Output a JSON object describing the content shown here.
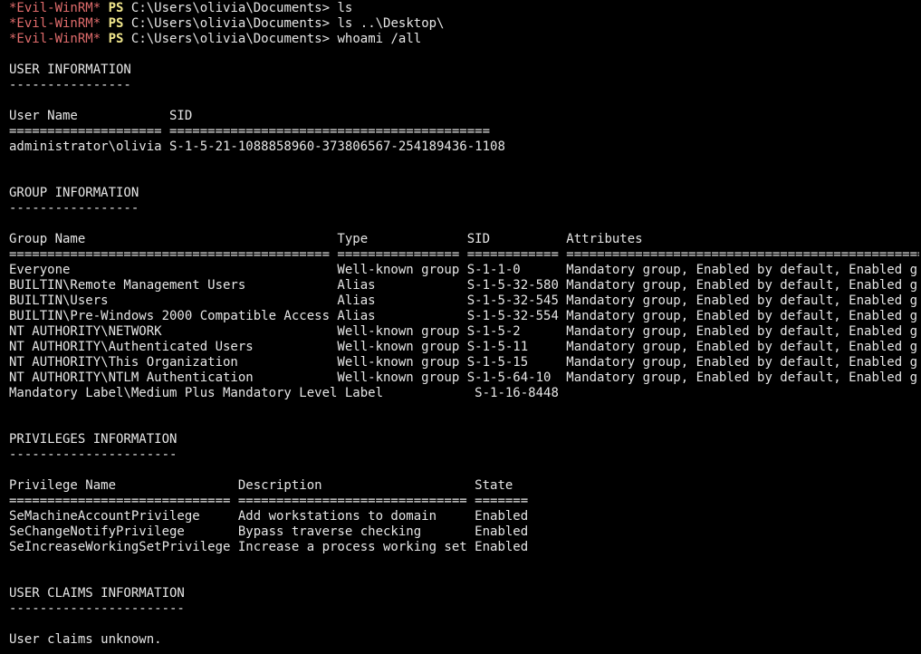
{
  "colors": {
    "background": "#000000",
    "text": "#e6e6e6",
    "prompt_tag": "#e06c6c",
    "ps": "#f0e68c"
  },
  "prompts": [
    {
      "tag": "*Evil-WinRM*",
      "ps": "PS",
      "path": "C:\\Users\\olivia\\Documents>",
      "command": "ls"
    },
    {
      "tag": "*Evil-WinRM*",
      "ps": "PS",
      "path": "C:\\Users\\olivia\\Documents>",
      "command": "ls ..\\Desktop\\"
    },
    {
      "tag": "*Evil-WinRM*",
      "ps": "PS",
      "path": "C:\\Users\\olivia\\Documents>",
      "command": "whoami /all"
    }
  ],
  "output": {
    "user_info": {
      "title": "USER INFORMATION",
      "underline": "----------------",
      "header": "User Name            SID",
      "separator": "==================== ==========================================",
      "row": "administrator\\olivia S-1-5-21-1088858960-373806567-254189436-1108"
    },
    "group_info": {
      "title": "GROUP INFORMATION",
      "underline": "-----------------",
      "header": "Group Name                                 Type             SID          Attributes",
      "separator": "========================================== ================ ============ ==================================================",
      "rows": [
        "Everyone                                   Well-known group S-1-1-0      Mandatory group, Enabled by default, Enabled group",
        "BUILTIN\\Remote Management Users            Alias            S-1-5-32-580 Mandatory group, Enabled by default, Enabled group",
        "BUILTIN\\Users                              Alias            S-1-5-32-545 Mandatory group, Enabled by default, Enabled group",
        "BUILTIN\\Pre-Windows 2000 Compatible Access Alias            S-1-5-32-554 Mandatory group, Enabled by default, Enabled group",
        "NT AUTHORITY\\NETWORK                       Well-known group S-1-5-2      Mandatory group, Enabled by default, Enabled group",
        "NT AUTHORITY\\Authenticated Users           Well-known group S-1-5-11     Mandatory group, Enabled by default, Enabled group",
        "NT AUTHORITY\\This Organization             Well-known group S-1-5-15     Mandatory group, Enabled by default, Enabled group",
        "NT AUTHORITY\\NTLM Authentication           Well-known group S-1-5-64-10  Mandatory group, Enabled by default, Enabled group",
        "Mandatory Label\\Medium Plus Mandatory Level Label            S-1-16-8448"
      ]
    },
    "privileges_info": {
      "title": "PRIVILEGES INFORMATION",
      "underline": "----------------------",
      "header": "Privilege Name                Description                    State",
      "separator": "============================= ============================== =======",
      "rows": [
        "SeMachineAccountPrivilege     Add workstations to domain     Enabled",
        "SeChangeNotifyPrivilege       Bypass traverse checking       Enabled",
        "SeIncreaseWorkingSetPrivilege Increase a process working set Enabled"
      ]
    },
    "user_claims_info": {
      "title": "USER CLAIMS INFORMATION",
      "underline": "-----------------------",
      "text": "User claims unknown."
    }
  }
}
